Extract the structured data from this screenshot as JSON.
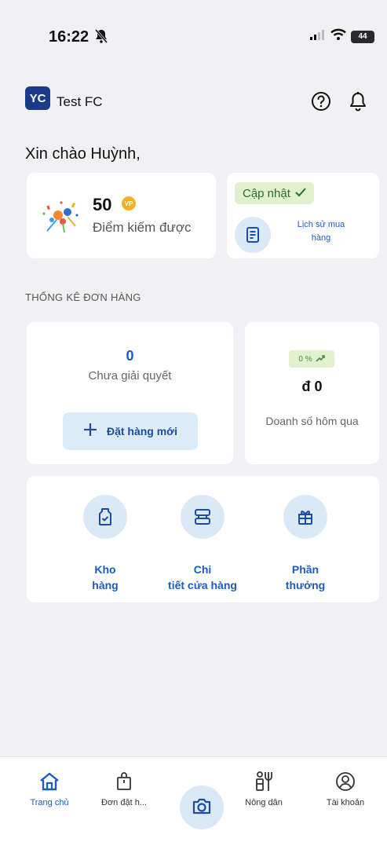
{
  "status_bar": {
    "time": "16:22",
    "battery_level": "44"
  },
  "header": {
    "logo_text": "YC",
    "brand_name": "Test FC"
  },
  "greeting": "Xin chào Huỳnh,",
  "points_card": {
    "value": "50",
    "currency_badge": "VP",
    "label": "Điểm kiếm được"
  },
  "history_card": {
    "update_label": "Cập nhật",
    "link_line1": "Lịch sử mua",
    "link_line2": "hàng"
  },
  "section_title": "THỐNG KÊ ĐƠN HÀNG",
  "pending_card": {
    "count": "0",
    "label": "Chưa giải quyết",
    "new_order_label": "Đặt hàng mới"
  },
  "sales_card": {
    "trend": "0 %",
    "value": "đ 0",
    "label": "Doanh số hôm qua"
  },
  "quick_actions": [
    {
      "label": "Kho\nhàng",
      "icon": "warehouse-icon"
    },
    {
      "label": "Chi\ntiết cửa hàng",
      "icon": "store-icon"
    },
    {
      "label": "Phần\nthưởng",
      "icon": "gift-icon"
    }
  ],
  "bottom_nav": [
    {
      "label": "Trang chủ",
      "icon": "home-icon",
      "active": true
    },
    {
      "label": "Đơn đặt h...",
      "icon": "shopping-bag-icon",
      "active": false
    },
    {
      "label": "Nông dân",
      "icon": "farmer-icon",
      "active": false
    },
    {
      "label": "Tài khoản",
      "icon": "account-icon",
      "active": false
    }
  ],
  "colors": {
    "primary": "#1a5cc2",
    "accent_light": "#dbe9f7",
    "success_light": "#e1f0cf",
    "background": "#f1f1f3",
    "logo": "#1b3a8a",
    "coin": "#f2b124"
  }
}
